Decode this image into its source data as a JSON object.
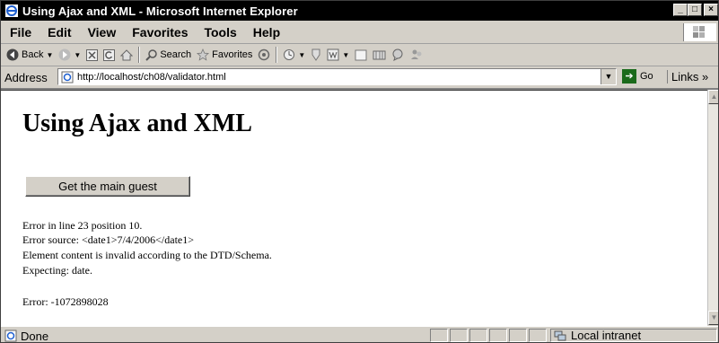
{
  "window": {
    "title": "Using Ajax and XML - Microsoft Internet Explorer",
    "buttons": {
      "minimize": "_",
      "maximize": "□",
      "close": "×"
    }
  },
  "menu": [
    "File",
    "Edit",
    "View",
    "Favorites",
    "Tools",
    "Help"
  ],
  "toolbar": {
    "back_label": "Back",
    "search_label": "Search",
    "favorites_label": "Favorites"
  },
  "address": {
    "label": "Address",
    "url": "http://localhost/ch08/validator.html",
    "go_label": "Go",
    "links_label": "Links »"
  },
  "page": {
    "heading": "Using Ajax and XML",
    "button_label": "Get the main guest",
    "error_lines": [
      "Error in  line 23 position 10.",
      "Error source:   <date1>7/4/2006</date1>",
      "Element content is invalid according to the DTD/Schema.",
      "Expecting: date."
    ],
    "error_code": "Error: -1072898028"
  },
  "status": {
    "text": "Done",
    "zone": "Local intranet"
  },
  "colors": {
    "title_bar": "#000000",
    "chrome": "#d4d0c8",
    "content_bg": "#ffffff",
    "go_green": "#1b6a1b"
  }
}
